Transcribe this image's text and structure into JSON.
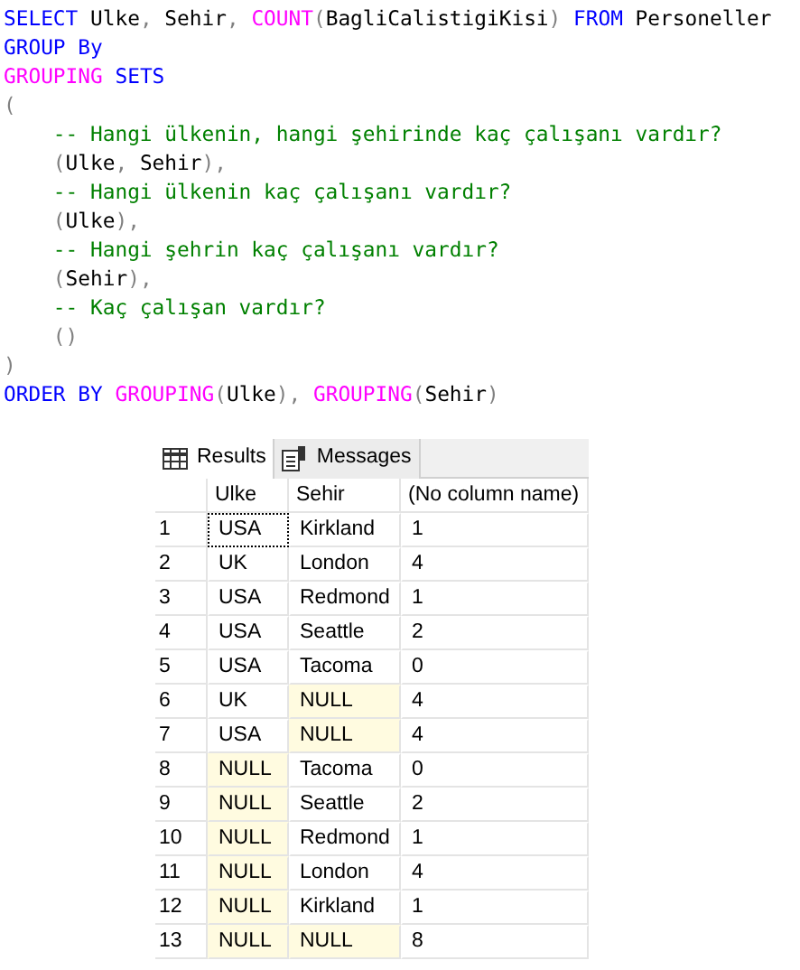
{
  "editor": {
    "lines": [
      {
        "tokens": [
          {
            "kind": "keyword",
            "text": "SELECT"
          },
          {
            "kind": "plain",
            "text": " Ulke"
          },
          {
            "kind": "punct",
            "text": ","
          },
          {
            "kind": "plain",
            "text": " Sehir"
          },
          {
            "kind": "punct",
            "text": ", "
          },
          {
            "kind": "function",
            "text": "COUNT"
          },
          {
            "kind": "punct",
            "text": "("
          },
          {
            "kind": "plain",
            "text": "BagliCalistigiKisi"
          },
          {
            "kind": "punct",
            "text": ")"
          },
          {
            "kind": "keyword",
            "text": " FROM"
          },
          {
            "kind": "plain",
            "text": " Personeller"
          }
        ]
      },
      {
        "tokens": [
          {
            "kind": "keyword",
            "text": "GROUP By"
          }
        ]
      },
      {
        "tokens": [
          {
            "kind": "function",
            "text": "GROUPING"
          },
          {
            "kind": "keyword",
            "text": " SETS"
          }
        ]
      },
      {
        "tokens": [
          {
            "kind": "punct",
            "text": "("
          }
        ]
      },
      {
        "tokens": [
          {
            "kind": "comment",
            "text": "    -- Hangi ülkenin, hangi şehirinde kaç çalışanı vardır?"
          }
        ]
      },
      {
        "tokens": [
          {
            "kind": "punct",
            "text": "    ("
          },
          {
            "kind": "plain",
            "text": "Ulke"
          },
          {
            "kind": "punct",
            "text": ","
          },
          {
            "kind": "plain",
            "text": " Sehir"
          },
          {
            "kind": "punct",
            "text": "),"
          }
        ]
      },
      {
        "tokens": [
          {
            "kind": "comment",
            "text": "    -- Hangi ülkenin kaç çalışanı vardır?"
          }
        ]
      },
      {
        "tokens": [
          {
            "kind": "punct",
            "text": "    ("
          },
          {
            "kind": "plain",
            "text": "Ulke"
          },
          {
            "kind": "punct",
            "text": "),"
          }
        ]
      },
      {
        "tokens": [
          {
            "kind": "comment",
            "text": "    -- Hangi şehrin kaç çalışanı vardır?"
          }
        ]
      },
      {
        "tokens": [
          {
            "kind": "punct",
            "text": "    ("
          },
          {
            "kind": "plain",
            "text": "Sehir"
          },
          {
            "kind": "punct",
            "text": "),"
          }
        ]
      },
      {
        "tokens": [
          {
            "kind": "comment",
            "text": "    -- Kaç çalışan vardır?"
          }
        ]
      },
      {
        "tokens": [
          {
            "kind": "punct",
            "text": "    ()"
          }
        ]
      },
      {
        "tokens": [
          {
            "kind": "punct",
            "text": ")"
          }
        ]
      },
      {
        "tokens": [
          {
            "kind": "keyword",
            "text": "ORDER BY"
          },
          {
            "kind": "function",
            "text": " GROUPING"
          },
          {
            "kind": "punct",
            "text": "("
          },
          {
            "kind": "plain",
            "text": "Ulke"
          },
          {
            "kind": "punct",
            "text": "), "
          },
          {
            "kind": "function",
            "text": "GROUPING"
          },
          {
            "kind": "punct",
            "text": "("
          },
          {
            "kind": "plain",
            "text": "Sehir"
          },
          {
            "kind": "punct",
            "text": ")"
          }
        ]
      }
    ]
  },
  "results": {
    "tabs": [
      {
        "label": "Results",
        "kind": "grid",
        "selected": true
      },
      {
        "label": "Messages",
        "kind": "messages",
        "selected": false
      }
    ],
    "columns": [
      "Ulke",
      "Sehir",
      "(No column name)"
    ],
    "rows": [
      {
        "num": "1",
        "cells": [
          {
            "text": "USA",
            "null": false,
            "focused": true
          },
          {
            "text": "Kirkland",
            "null": false,
            "focused": false
          },
          {
            "text": "1",
            "null": false,
            "focused": false
          }
        ]
      },
      {
        "num": "2",
        "cells": [
          {
            "text": "UK",
            "null": false,
            "focused": false
          },
          {
            "text": "London",
            "null": false,
            "focused": false
          },
          {
            "text": "4",
            "null": false,
            "focused": false
          }
        ]
      },
      {
        "num": "3",
        "cells": [
          {
            "text": "USA",
            "null": false,
            "focused": false
          },
          {
            "text": "Redmond",
            "null": false,
            "focused": false
          },
          {
            "text": "1",
            "null": false,
            "focused": false
          }
        ]
      },
      {
        "num": "4",
        "cells": [
          {
            "text": "USA",
            "null": false,
            "focused": false
          },
          {
            "text": "Seattle",
            "null": false,
            "focused": false
          },
          {
            "text": "2",
            "null": false,
            "focused": false
          }
        ]
      },
      {
        "num": "5",
        "cells": [
          {
            "text": "USA",
            "null": false,
            "focused": false
          },
          {
            "text": "Tacoma",
            "null": false,
            "focused": false
          },
          {
            "text": "0",
            "null": false,
            "focused": false
          }
        ]
      },
      {
        "num": "6",
        "cells": [
          {
            "text": "UK",
            "null": false,
            "focused": false
          },
          {
            "text": "NULL",
            "null": true,
            "focused": false
          },
          {
            "text": "4",
            "null": false,
            "focused": false
          }
        ]
      },
      {
        "num": "7",
        "cells": [
          {
            "text": "USA",
            "null": false,
            "focused": false
          },
          {
            "text": "NULL",
            "null": true,
            "focused": false
          },
          {
            "text": "4",
            "null": false,
            "focused": false
          }
        ]
      },
      {
        "num": "8",
        "cells": [
          {
            "text": "NULL",
            "null": true,
            "focused": false
          },
          {
            "text": "Tacoma",
            "null": false,
            "focused": false
          },
          {
            "text": "0",
            "null": false,
            "focused": false
          }
        ]
      },
      {
        "num": "9",
        "cells": [
          {
            "text": "NULL",
            "null": true,
            "focused": false
          },
          {
            "text": "Seattle",
            "null": false,
            "focused": false
          },
          {
            "text": "2",
            "null": false,
            "focused": false
          }
        ]
      },
      {
        "num": "10",
        "cells": [
          {
            "text": "NULL",
            "null": true,
            "focused": false
          },
          {
            "text": "Redmond",
            "null": false,
            "focused": false
          },
          {
            "text": "1",
            "null": false,
            "focused": false
          }
        ]
      },
      {
        "num": "11",
        "cells": [
          {
            "text": "NULL",
            "null": true,
            "focused": false
          },
          {
            "text": "London",
            "null": false,
            "focused": false
          },
          {
            "text": "4",
            "null": false,
            "focused": false
          }
        ]
      },
      {
        "num": "12",
        "cells": [
          {
            "text": "NULL",
            "null": true,
            "focused": false
          },
          {
            "text": "Kirkland",
            "null": false,
            "focused": false
          },
          {
            "text": "1",
            "null": false,
            "focused": false
          }
        ]
      },
      {
        "num": "13",
        "cells": [
          {
            "text": "NULL",
            "null": true,
            "focused": false
          },
          {
            "text": "NULL",
            "null": true,
            "focused": false
          },
          {
            "text": "8",
            "null": false,
            "focused": false
          }
        ]
      }
    ]
  }
}
